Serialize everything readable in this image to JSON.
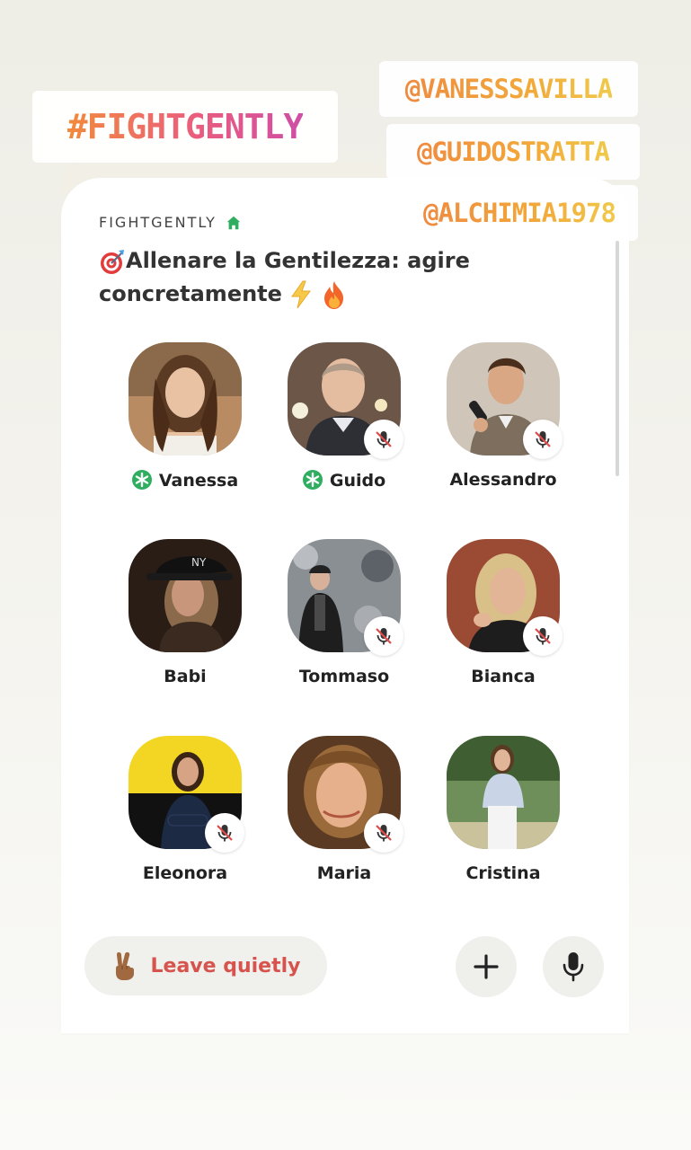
{
  "stickers": {
    "hashtag": "#FIGHTGENTLY",
    "mentions": [
      "@VANESSSAVILLA",
      "@GUIDOSTRATTA",
      "@ALCHIMIA1978"
    ]
  },
  "room": {
    "club_name": "FIGHTGENTLY",
    "title_line1": "Allenare la Gentilezza: agire",
    "title_line2": "concretamente",
    "icons": [
      "target-icon",
      "lightning-icon",
      "fire-icon",
      "home-icon"
    ]
  },
  "speakers": [
    {
      "name": "Vanessa",
      "moderator": true,
      "muted": false
    },
    {
      "name": "Guido",
      "moderator": true,
      "muted": true
    },
    {
      "name": "Alessandro",
      "moderator": false,
      "muted": true
    },
    {
      "name": "Babi",
      "moderator": false,
      "muted": false
    },
    {
      "name": "Tommaso",
      "moderator": false,
      "muted": true
    },
    {
      "name": "Bianca",
      "moderator": false,
      "muted": true
    },
    {
      "name": "Eleonora",
      "moderator": false,
      "muted": true
    },
    {
      "name": "Maria",
      "moderator": false,
      "muted": true
    },
    {
      "name": "Cristina",
      "moderator": false,
      "muted": false
    }
  ],
  "controls": {
    "leave_label": "Leave quietly",
    "leave_icon": "victory-hand-icon",
    "add_icon": "plus-icon",
    "mic_icon": "microphone-icon"
  },
  "colors": {
    "moderator_green": "#2fae60",
    "leave_red": "#d6544d",
    "hashtag_gradient": [
      "#f28a3c",
      "#cf4ea6"
    ],
    "mention_gradient": [
      "#ef8a3f",
      "#f0c94a"
    ]
  }
}
